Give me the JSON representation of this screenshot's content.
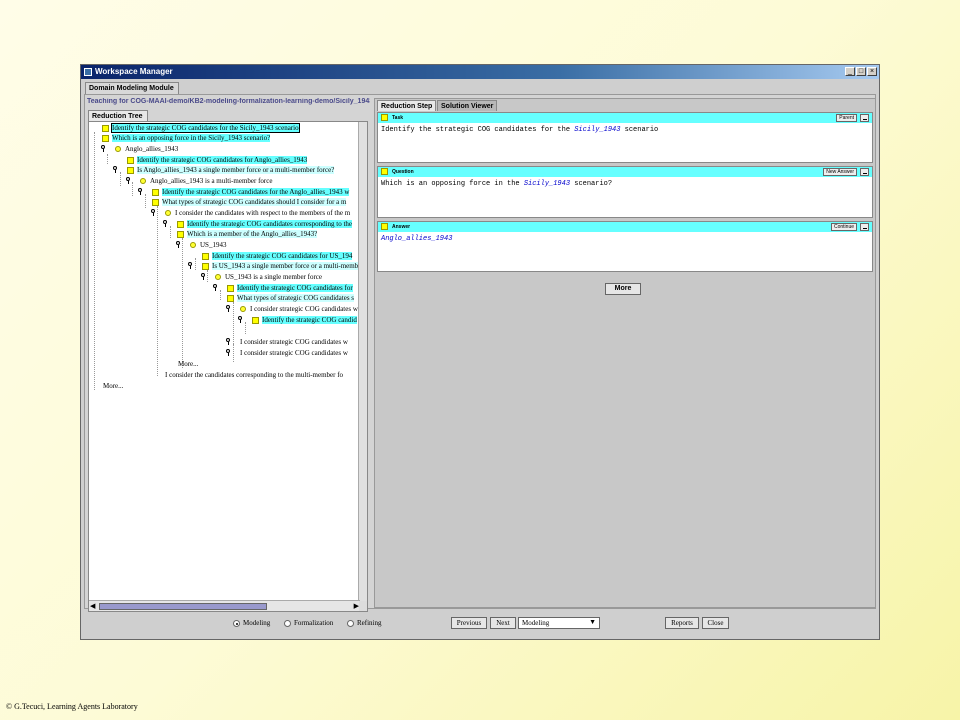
{
  "window": {
    "title": "Workspace Manager",
    "btn_min": "_",
    "btn_max": "□",
    "btn_close": "×"
  },
  "module_tab": "Domain Modeling Module",
  "path": "Teaching for COG-MAAI-demo/KB2-modeling-formalization-learning-demo/Sicily_1943",
  "left_tab": "Reduction Tree",
  "tree": [
    "Identify the strategic COG candidates for the Sicily_1943 scenario",
    "Which is an opposing force in the Sicily_1943 scenario?",
    "Anglo_allies_1943",
    "Identify the strategic COG candidates for Anglo_allies_1943",
    "Is Anglo_allies_1943 a single member force or a multi-member force?",
    "Anglo_allies_1943 is a multi-member force",
    "Identify the strategic COG candidates for the Anglo_allies_1943 w",
    "What types of strategic COG candidates should I consider for a m",
    "I consider the candidates with respect to the members of the m",
    "Identify the strategic COG candidates corresponding to the",
    "Which is a member of the Anglo_allies_1943?",
    "US_1943",
    "Identify the strategic COG candidates for US_194",
    "Is US_1943 a single member force or a multi-memb",
    "US_1943 is a single member force",
    "Identify the strategic COG candidates for",
    "What types of strategic COG candidates s",
    "I consider strategic COG candidates w",
    "Identify the strategic COG candid",
    "I consider strategic COG candidates w",
    "I consider strategic COG candidates w",
    "More...",
    "I consider the candidates corresponding to the multi-member fo",
    "More..."
  ],
  "right_tabs": [
    "Reduction Step",
    "Solution Viewer"
  ],
  "task": {
    "label": "Task",
    "button": "Parent",
    "text_pre": "Identify the strategic COG candidates for the ",
    "text_it": "Sicily_1943",
    "text_post": " scenario"
  },
  "question": {
    "label": "Question",
    "button": "New Answer",
    "text_pre": "Which is an opposing force in the ",
    "text_it": "Sicily_1943",
    "text_post": " scenario?"
  },
  "answer": {
    "label": "Answer",
    "button": "Continue",
    "text": "Anglo_allies_1943"
  },
  "more_button": "More",
  "bottom": {
    "radio_modeling": "Modeling",
    "radio_formalization": "Formalization",
    "radio_refining": "Refining",
    "previous": "Previous",
    "next": "Next",
    "combo_value": "Modeling",
    "reports": "Reports",
    "close": "Close"
  },
  "footer": "© G.Tecuci, Learning Agents Laboratory"
}
